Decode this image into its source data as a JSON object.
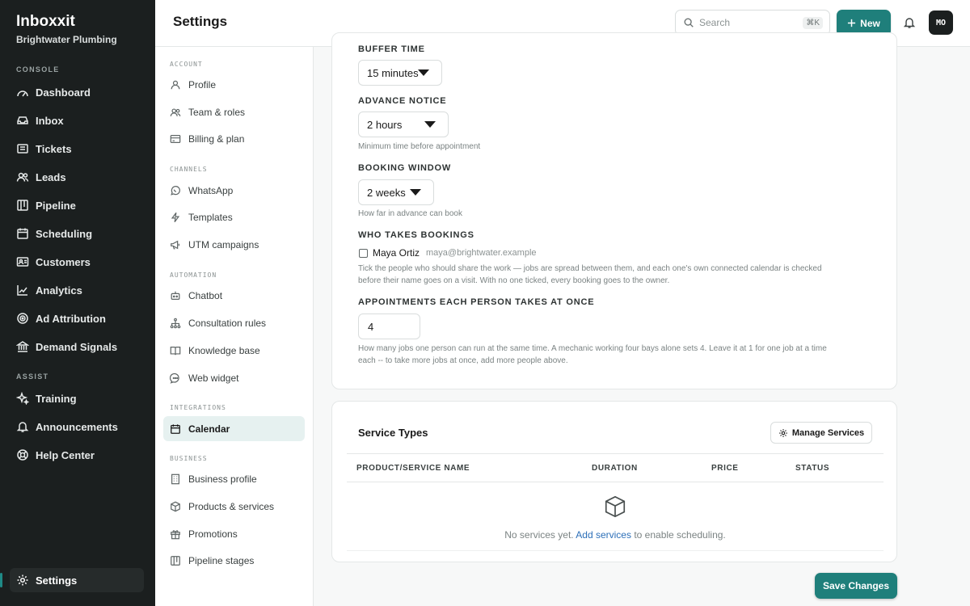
{
  "app": {
    "name": "Inboxxit",
    "org": "Brightwater Plumbing"
  },
  "rail": {
    "console_label": "CONSOLE",
    "console": [
      {
        "label": "Dashboard",
        "icon": "dashboard-icon"
      },
      {
        "label": "Inbox",
        "icon": "inbox-icon"
      },
      {
        "label": "Tickets",
        "icon": "ticket-icon"
      },
      {
        "label": "Leads",
        "icon": "users-icon"
      },
      {
        "label": "Pipeline",
        "icon": "pipeline-icon"
      },
      {
        "label": "Scheduling",
        "icon": "calendar-icon"
      },
      {
        "label": "Customers",
        "icon": "contact-card-icon"
      },
      {
        "label": "Analytics",
        "icon": "trend-icon"
      },
      {
        "label": "Ad Attribution",
        "icon": "target-icon"
      },
      {
        "label": "Demand Signals",
        "icon": "bank-icon"
      }
    ],
    "assist_label": "ASSIST",
    "assist": [
      {
        "label": "Training",
        "icon": "sparkle-icon"
      },
      {
        "label": "Announcements",
        "icon": "bell-icon"
      },
      {
        "label": "Help Center",
        "icon": "lifebuoy-icon"
      }
    ],
    "settings_label": "Settings"
  },
  "header": {
    "title": "Settings",
    "search_placeholder": "Search",
    "search_shortcut": "⌘K",
    "new_label": "New",
    "avatar_initials": "MO"
  },
  "settings_nav": {
    "sections": [
      {
        "label": "ACCOUNT",
        "items": [
          "Profile",
          "Team & roles",
          "Billing & plan"
        ]
      },
      {
        "label": "CHANNELS",
        "items": [
          "WhatsApp",
          "Templates",
          "UTM campaigns"
        ]
      },
      {
        "label": "AUTOMATION",
        "items": [
          "Chatbot",
          "Consultation rules",
          "Knowledge base",
          "Web widget"
        ]
      },
      {
        "label": "INTEGRATIONS",
        "items": [
          "Calendar"
        ]
      },
      {
        "label": "BUSINESS",
        "items": [
          "Business profile",
          "Products & services",
          "Promotions",
          "Pipeline stages"
        ]
      }
    ],
    "active": "Calendar"
  },
  "form": {
    "buffer": {
      "label": "BUFFER TIME",
      "value": "15 minutes"
    },
    "notice": {
      "label": "ADVANCE NOTICE",
      "value": "2 hours",
      "help": "Minimum time before appointment"
    },
    "window": {
      "label": "BOOKING WINDOW",
      "value": "2 weeks",
      "help": "How far in advance can book"
    },
    "who": {
      "label": "WHO TAKES BOOKINGS",
      "person_name": "Maya Ortiz",
      "person_email": "maya@brightwater.example",
      "person_checked": false,
      "help_line1": "Tick the people who should share the work — jobs are spread between them, and each one's own connected calendar is checked",
      "help_line2": "before their name goes on a visit. With no one ticked, every booking goes to the owner."
    },
    "capacity": {
      "label": "APPOINTMENTS EACH PERSON TAKES AT ONCE",
      "value": "4",
      "help_line1": "How many jobs one person can run at the same time. A mechanic working four bays alone sets 4. Leave it at 1 for one job at a time",
      "help_line2": "each -- to take more jobs at once, add more people above."
    }
  },
  "services": {
    "title": "Service Types",
    "manage_label": "Manage Services",
    "columns": [
      "PRODUCT/SERVICE NAME",
      "DURATION",
      "PRICE",
      "STATUS"
    ],
    "empty_prefix": "No services yet.",
    "empty_link": "Add services",
    "empty_suffix": "to enable scheduling."
  },
  "save_label": "Save Changes"
}
